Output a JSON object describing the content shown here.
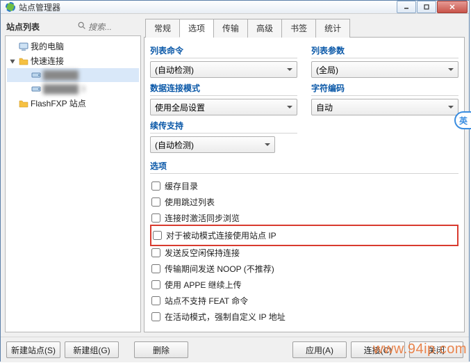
{
  "window": {
    "title": "站点管理器"
  },
  "left": {
    "title": "站点列表",
    "search_placeholder": "搜索...",
    "tree": {
      "my_computer": "我的电脑",
      "quick_connect": "快速连接",
      "node_a": "██████",
      "node_b": "██████ 3",
      "flashfxp": "FlashFXP 站点"
    }
  },
  "tabs": {
    "general": "常规",
    "options": "选项",
    "transfer": "传输",
    "advanced": "高级",
    "bookmarks": "书签",
    "stats": "统计"
  },
  "options": {
    "list_command": {
      "label": "列表命令",
      "value": "(自动检测)"
    },
    "list_params": {
      "label": "列表参数",
      "value": "(全局)"
    },
    "data_mode": {
      "label": "数据连接模式",
      "value": "使用全局设置"
    },
    "char_encoding": {
      "label": "字符编码",
      "value": "自动"
    },
    "resume": {
      "label": "续传支持",
      "value": "(自动检测)"
    },
    "section_options": "选项",
    "checks": {
      "cache_dir": "缓存目录",
      "skip_list": "使用跳过列表",
      "sync_browse": "连接时激活同步浏览",
      "pasv_ip": "对于被动模式连接使用站点 IP",
      "anti_idle": "发送反空闲保持连接",
      "noop": "传输期间发送 NOOP (不推荐)",
      "appe": "使用 APPE 继续上传",
      "no_feat": "站点不支持 FEAT 命令",
      "force_ip": "在活动模式，强制自定义 IP 地址"
    }
  },
  "footer": {
    "new_site": "新建站点(S)",
    "new_group": "新建组(G)",
    "delete": "删除",
    "apply": "应用(A)",
    "connect": "连接(C)",
    "close": "关闭"
  },
  "ime": "英"
}
